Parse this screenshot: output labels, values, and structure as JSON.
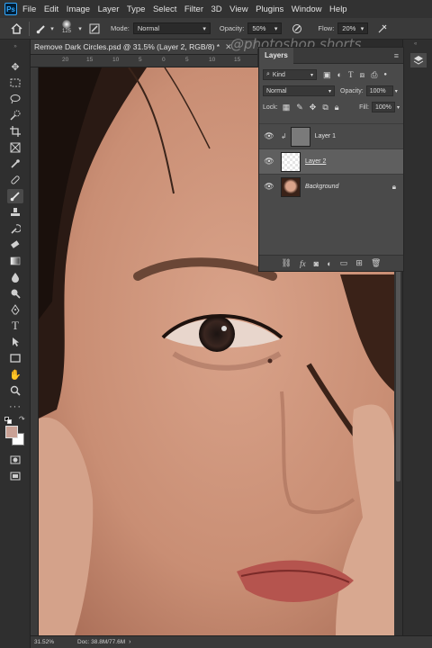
{
  "menubar": {
    "logo": "Ps",
    "items": [
      "File",
      "Edit",
      "Image",
      "Layer",
      "Type",
      "Select",
      "Filter",
      "3D",
      "View",
      "Plugins",
      "Window",
      "Help"
    ]
  },
  "options": {
    "brush_size": "125",
    "mode_label": "Mode:",
    "mode_value": "Normal",
    "opacity_label": "Opacity:",
    "opacity_value": "50%",
    "flow_label": "Flow:",
    "flow_value": "20%"
  },
  "document": {
    "tab_title": "Remove Dark Circles.psd @ 31.5% (Layer 2, RGB/8) *",
    "watermark": "@photoshop shorts"
  },
  "ruler": {
    "numbers": [
      "20",
      "15",
      "10",
      "5",
      "0",
      "5",
      "10",
      "15"
    ]
  },
  "status": {
    "zoom": "31.52%",
    "doc": "Doc: 38.8M/77.6M"
  },
  "layers_panel": {
    "title": "Layers",
    "filter_value": "Kind",
    "blend_mode": "Normal",
    "opacity_label": "Opacity:",
    "opacity_value": "100%",
    "lock_label": "Lock:",
    "fill_label": "Fill:",
    "fill_value": "100%",
    "layers": [
      {
        "name": "Layer 1"
      },
      {
        "name": "Layer 2"
      },
      {
        "name": "Background"
      }
    ]
  },
  "colors": {
    "foreground": "#c9a195",
    "background": "#ffffff",
    "annotation_arrow": "#e11b1b",
    "ps_brand": "#31a8ff"
  },
  "icons": {
    "tools": [
      "move-tool",
      "artboard-tool",
      "lasso-tool",
      "quick-select-tool",
      "crop-tool",
      "frame-tool",
      "eyedropper-tool",
      "healing-brush-tool",
      "brush-tool",
      "clone-stamp-tool",
      "history-brush-tool",
      "eraser-tool",
      "gradient-tool",
      "blur-tool",
      "dodge-tool",
      "pen-tool",
      "type-tool",
      "path-selection-tool",
      "rectangle-tool",
      "hand-tool",
      "zoom-tool",
      "more-tools"
    ]
  }
}
